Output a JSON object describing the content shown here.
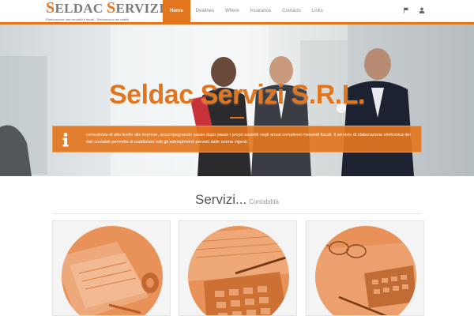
{
  "brand": {
    "title_cap1": "S",
    "title_rest1": "ELDAC",
    "title_cap2": "S",
    "title_rest2": "ERVIZI",
    "title_suffix": "srl",
    "subtitle": "Elaborazione dati contabili e fiscali - Elaborazioni dei redditi"
  },
  "nav": {
    "items": [
      "Home",
      "Dealines",
      "Where",
      "Insurance",
      "Contacts",
      "Links"
    ],
    "active_index": 0,
    "icons": [
      "flag-icon",
      "user-icon"
    ]
  },
  "hero": {
    "title": "Seldac Servizi S.R.L.",
    "info_icon": "info-icon",
    "info_text": "consulenze di alto livello alle imprese, accompagnando passo dopo passo i propri assistiti negli arresi complessi mesandi fiscali. Il servizio di elaborazione elettronica dei dati contabili permette di soddisfare tutti gli adempimenti previsti dalle norme vigenti.",
    "slide_count": 1,
    "active_slide": 0
  },
  "services": {
    "title": "Servizi...",
    "subtitle": "Contabilità",
    "cards": [
      {
        "image": "documents-image"
      },
      {
        "image": "calculator-image"
      },
      {
        "image": "glasses-calculator-image"
      }
    ]
  },
  "colors": {
    "accent": "#e2761f",
    "card_circle": "#e8925a"
  }
}
